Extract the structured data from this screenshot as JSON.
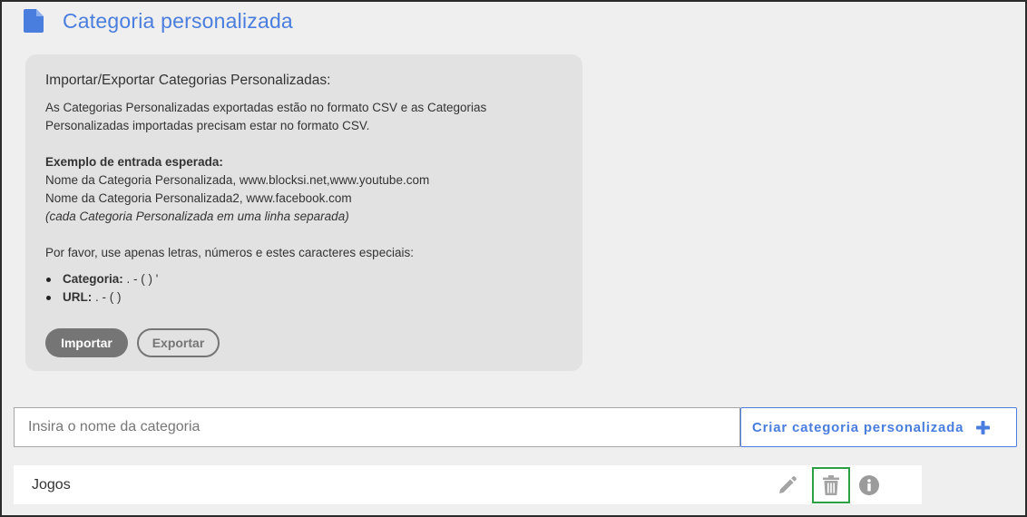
{
  "header": {
    "title": "Categoria personalizada",
    "icon": "file-icon",
    "accent_color": "#4a7ede"
  },
  "info_panel": {
    "title": "Importar/Exportar Categorias Personalizadas:",
    "intro_line1": "As Categorias Personalizadas exportadas estão no formato CSV e as Categorias",
    "intro_line2": "Personalizadas importadas precisam estar no formato CSV.",
    "example_heading": "Exemplo de entrada esperada:",
    "example_line1": "Nome da Categoria Personalizada, www.blocksi.net,www.youtube.com",
    "example_line2": "Nome da Categoria Personalizada2, www.facebook.com",
    "example_note": "(cada Categoria Personalizada em uma linha separada)",
    "chars_note": "Por favor, use apenas letras, números e estes caracteres especiais:",
    "rules": [
      {
        "label": "Categoria:",
        "value": " . - ( ) '"
      },
      {
        "label": "URL:",
        "value": " . - ( )"
      }
    ],
    "import_label": "Importar",
    "export_label": "Exportar"
  },
  "create": {
    "input_value": "",
    "input_placeholder": "Insira o nome da categoria",
    "button_label": "Criar categoria personalizada",
    "button_icon": "plus-icon"
  },
  "categories": [
    {
      "name": "Jogos",
      "actions": [
        "pencil-icon",
        "trash-icon",
        "info-icon"
      ]
    }
  ],
  "colors": {
    "accent": "#4a7ede",
    "highlight_border": "#2e9e47",
    "icon_gray": "#9b9b9b"
  }
}
